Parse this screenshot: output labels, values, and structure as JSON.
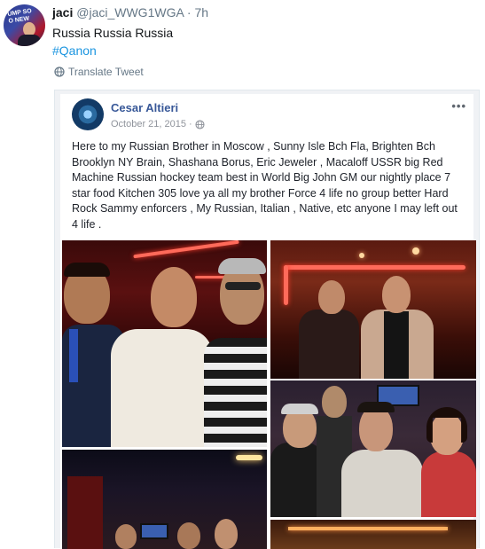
{
  "tweet": {
    "display_name": "jaci",
    "handle": "@jaci_WWG1WGA",
    "separator": " · ",
    "time": "7h",
    "text": "Russia Russia Russia",
    "hashtag": "#Qanon",
    "translate_label": "Translate Tweet",
    "avatar_text": "UMP SO\nO NEW",
    "icons": {
      "translate": "globe-icon"
    },
    "colors": {
      "link": "#1b95e0",
      "secondary": "#657786",
      "text": "#14171a"
    }
  },
  "facebook_post": {
    "author": "Cesar Altieri",
    "date": "October 21, 2015",
    "date_separator": " · ",
    "more_label": "•••",
    "body": "Here to my Russian Brother in Moscow , Sunny Isle Bch Fla, Brighten Bch Brooklyn NY Brain, Shashana Borus, Eric Jeweler , Macaloff USSR big Red Machine Russian hockey team best in World Big John GM our nightly place 7 star food Kitchen 305 love ya all my brother Force 4 life no group better Hard Rock Sammy enforcers , My Russian, Italian , Native, etc anyone I may left out 4 life .",
    "photos": [
      "photo-1",
      "photo-2",
      "photo-3",
      "photo-4",
      "photo-5"
    ],
    "icons": {
      "privacy": "world-icon",
      "more": "more-icon"
    },
    "colors": {
      "author": "#385898",
      "meta": "#90949c"
    }
  }
}
